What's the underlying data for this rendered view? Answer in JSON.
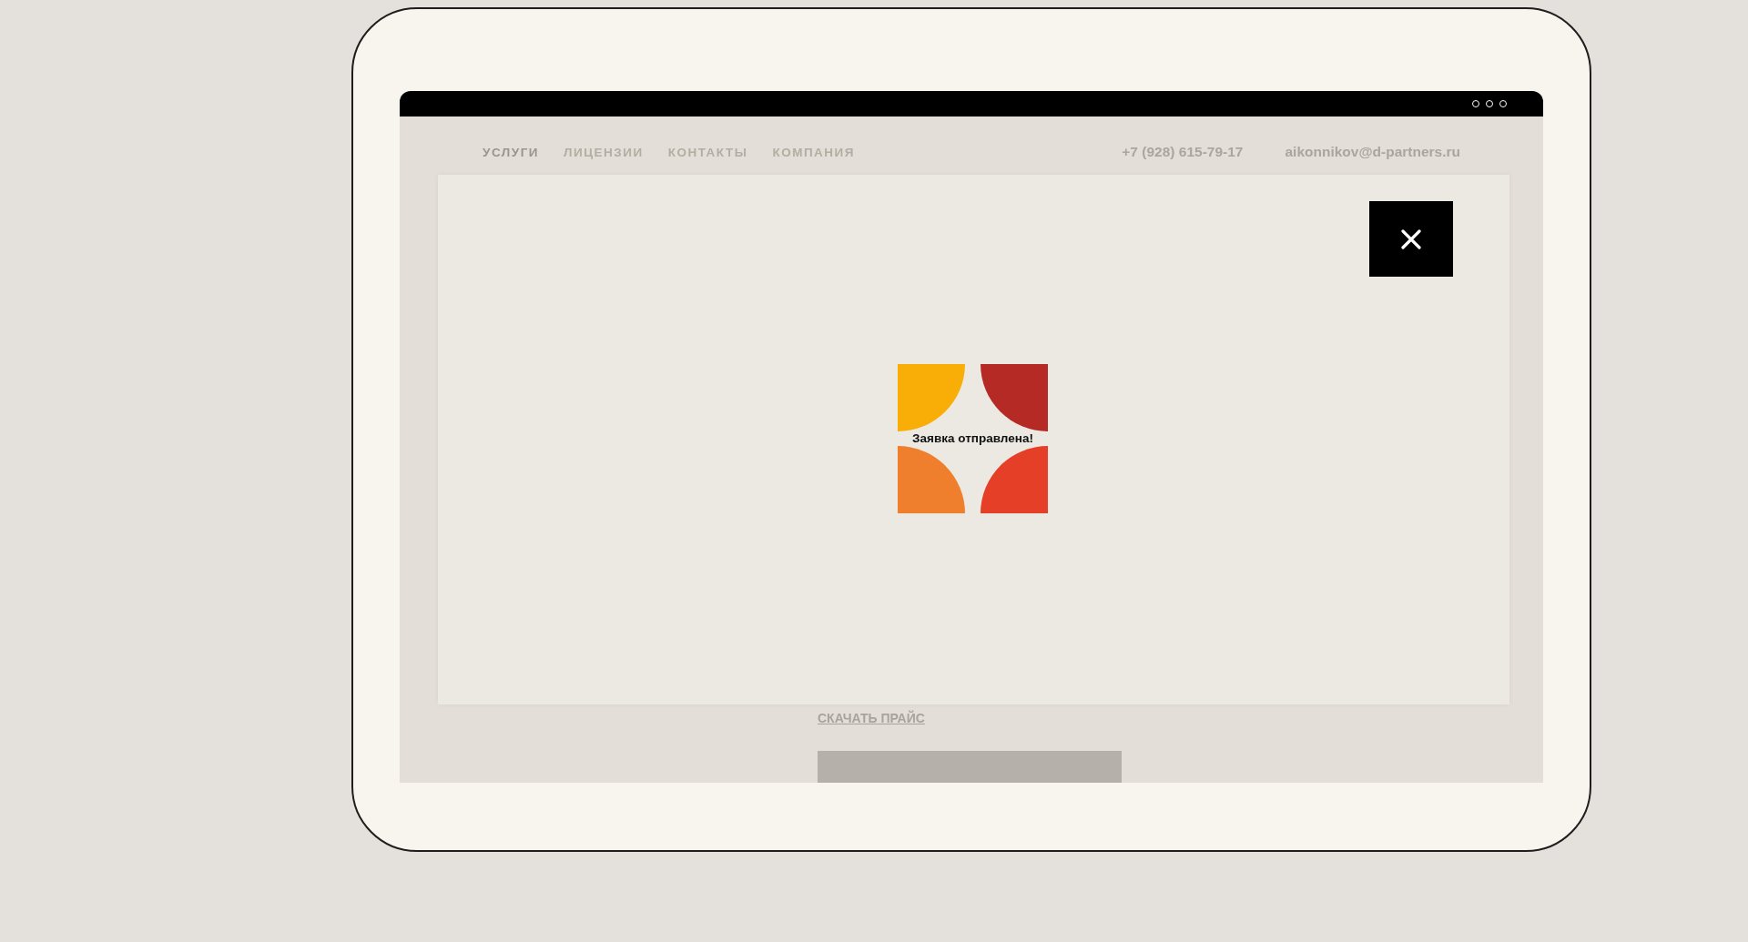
{
  "nav": {
    "items": [
      {
        "label": "УСЛУГИ",
        "selected": true
      },
      {
        "label": "ЛИЦЕНЗИИ",
        "selected": false
      },
      {
        "label": "КОНТАКТЫ",
        "selected": false
      },
      {
        "label": "КОМПАНИЯ",
        "selected": false
      }
    ],
    "phone": "+7 (928) 615-79-17",
    "email": "aikonnikov@d-partners.ru"
  },
  "content": {
    "link": "СКАЧАТЬ ПРАЙС"
  },
  "modal": {
    "message": "Заявка отправлена!"
  }
}
